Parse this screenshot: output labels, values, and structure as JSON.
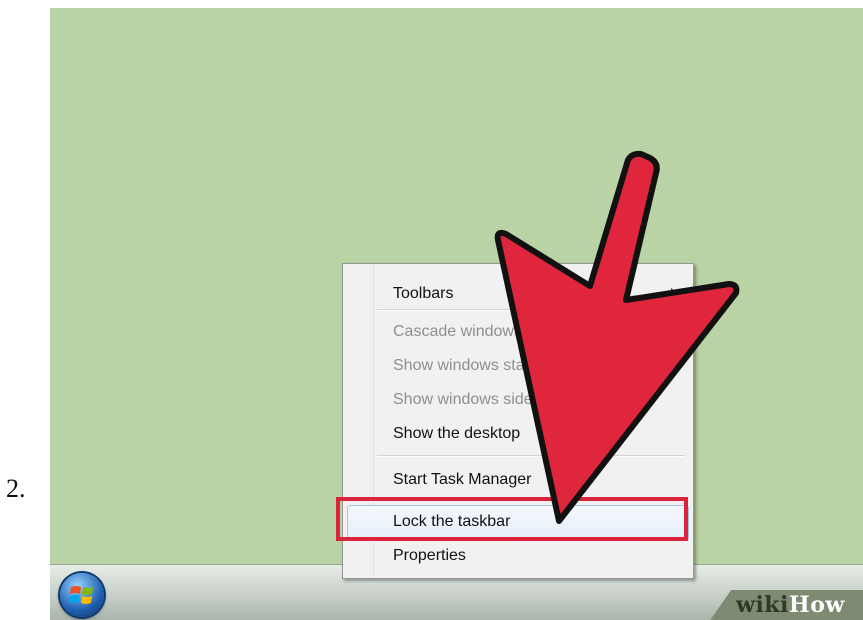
{
  "step": {
    "number": "2."
  },
  "menu": {
    "items": [
      {
        "label": "Toolbars",
        "enabled": true,
        "has_submenu": true
      },
      {
        "label": "Cascade windows",
        "enabled": false
      },
      {
        "label": "Show windows stacked",
        "enabled": false
      },
      {
        "label": "Show windows side by side",
        "enabled": false
      },
      {
        "label": "Show the desktop",
        "enabled": true
      },
      {
        "label": "Start Task Manager",
        "enabled": true
      },
      {
        "label": "Lock the taskbar",
        "enabled": true,
        "highlighted": true
      },
      {
        "label": "Properties",
        "enabled": true
      }
    ]
  },
  "brand": {
    "prefix": "wiki",
    "suffix": "How"
  },
  "colors": {
    "desktop": "#b9d3a4",
    "arrow": "#e0263c",
    "highlight": "#d9243c"
  },
  "icons": {
    "start": "windows-start-orb-icon",
    "arrow": "red-pointer-arrow"
  }
}
